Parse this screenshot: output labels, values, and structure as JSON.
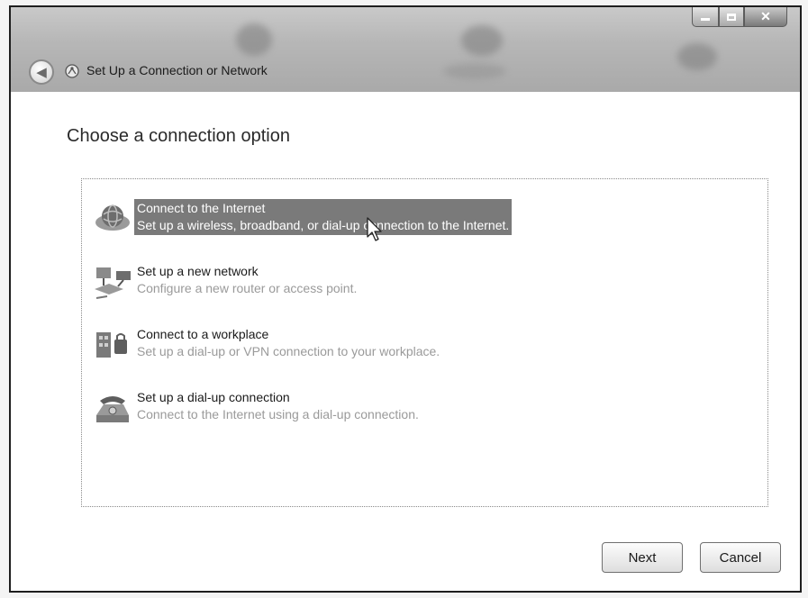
{
  "window": {
    "title": "Set Up a Connection or Network",
    "close_glyph": "✕",
    "back_glyph": "◀"
  },
  "main": {
    "heading": "Choose a connection option",
    "options": [
      {
        "title": "Connect to the Internet",
        "description": "Set up a wireless, broadband, or dial-up connection to the Internet.",
        "icon": "globe-icon",
        "selected": true
      },
      {
        "title": "Set up a new network",
        "description": "Configure a new router or access point.",
        "icon": "network-router-icon",
        "selected": false
      },
      {
        "title": "Connect to a workplace",
        "description": "Set up a dial-up or VPN connection to your workplace.",
        "icon": "workplace-vpn-icon",
        "selected": false
      },
      {
        "title": "Set up a dial-up connection",
        "description": "Connect to the Internet using a dial-up connection.",
        "icon": "dialup-phone-icon",
        "selected": false
      }
    ]
  },
  "footer": {
    "next_label": "Next",
    "cancel_label": "Cancel"
  },
  "colors": {
    "selection": "#7a7a7a",
    "titlebar": "#b7b7b7"
  }
}
